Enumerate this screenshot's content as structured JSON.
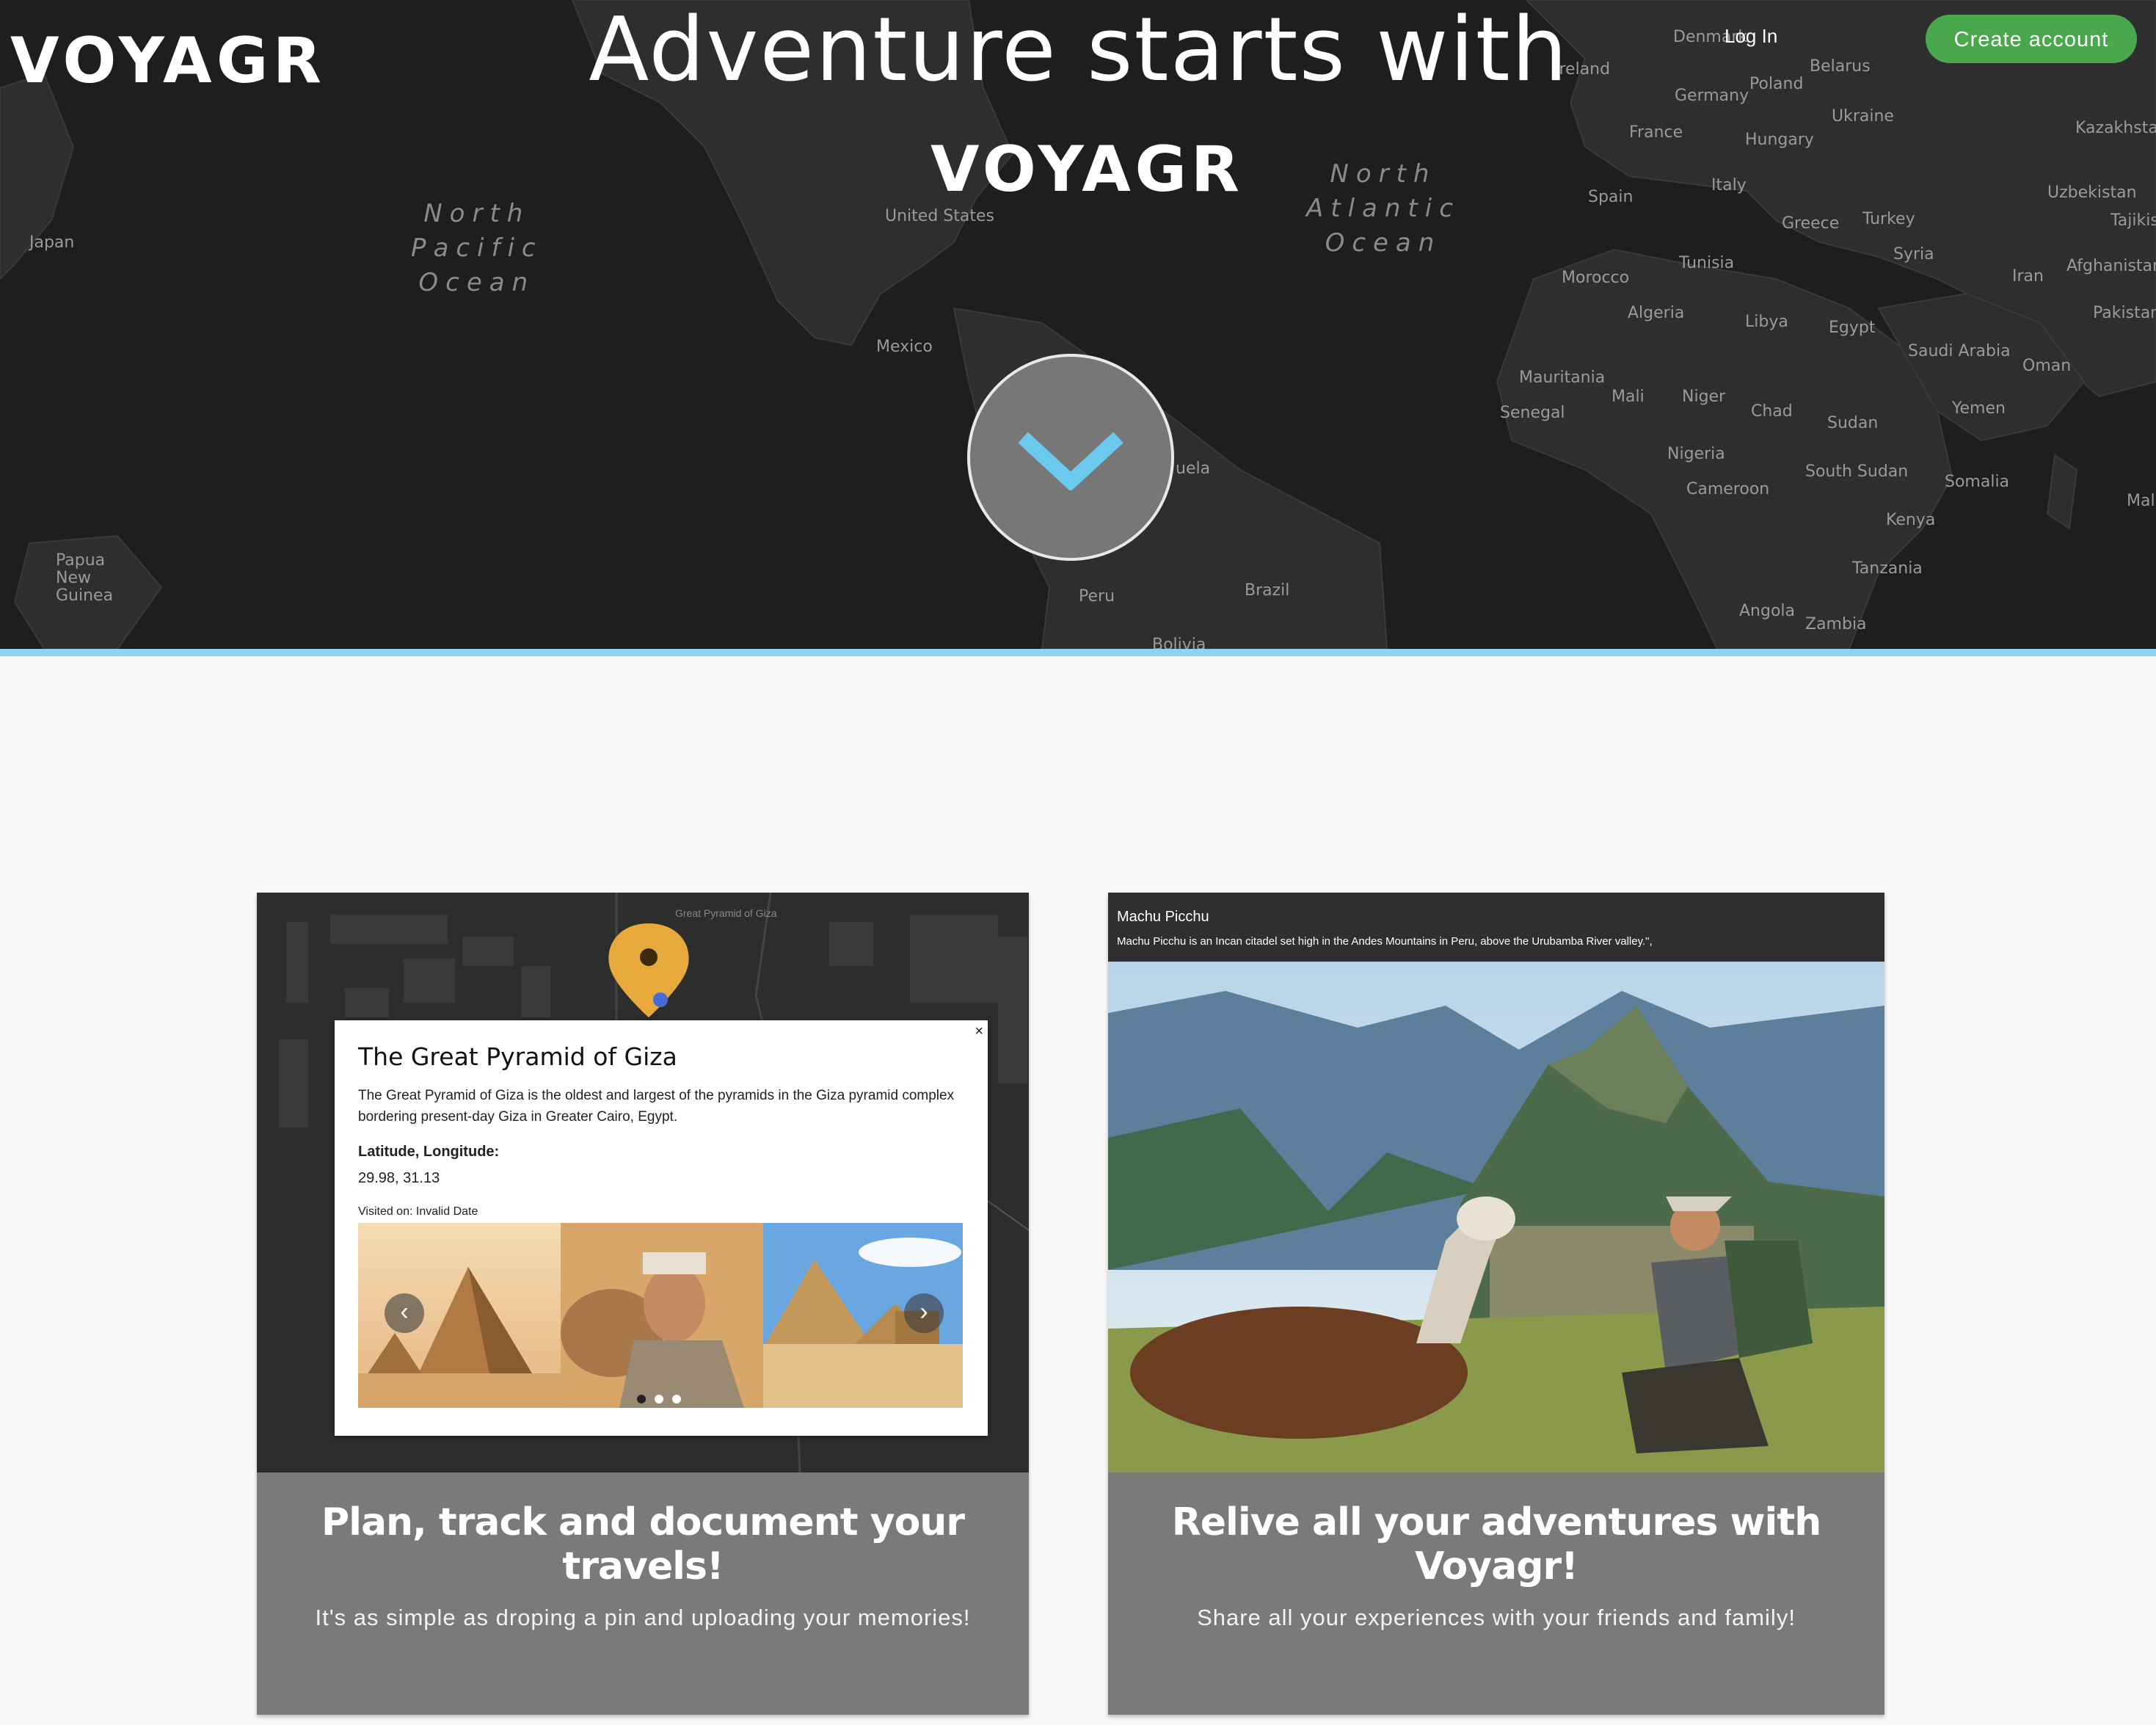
{
  "brand": {
    "logo_text": "VOYAGR"
  },
  "hero": {
    "headline": "Adventure starts with",
    "logo_text": "VOYAGR",
    "nav": {
      "login_label": "Log In",
      "create_account_label": "Create account"
    },
    "scroll_icon": "chevron-down-icon",
    "map_labels": [
      "Japan",
      "Papua New Guinea",
      "United States",
      "Mexico",
      "Brazil",
      "Peru",
      "Bolivia",
      "uela",
      "Ireland",
      "Denmark",
      "Belarus",
      "Poland",
      "Germany",
      "Ukraine",
      "France",
      "Hungary",
      "Kazakhstan",
      "Spain",
      "Italy",
      "Greece",
      "Turkey",
      "Uzbekistan",
      "Tajikis",
      "Morocco",
      "Tunisia",
      "Syria",
      "Iran",
      "Afghanistan",
      "Algeria",
      "Libya",
      "Egypt",
      "Pakistan",
      "Saudi Arabia",
      "Oman",
      "Mauritania",
      "Mali",
      "Niger",
      "Senegal",
      "Chad",
      "Sudan",
      "Yemen",
      "Nigeria",
      "South Sudan",
      "Somalia",
      "Cameroon",
      "Kenya",
      "Mal",
      "Tanzania",
      "Angola",
      "Zambia"
    ],
    "oceans": [
      "North\nPacific\nOcean",
      "North\nAtlantic\nOcean"
    ],
    "accent_border": "#8fd5f3"
  },
  "cards": [
    {
      "title": "Plan, track and document your travels!",
      "subtitle": "It's as simple as droping a pin and uploading your memories!",
      "map_pin_label": "Great Pyramid of Giza",
      "popup": {
        "title": "The Great Pyramid of Giza",
        "description": "The Great Pyramid of Giza is the oldest and largest of the pyramids in the Giza pyramid complex bordering present-day Giza in Greater Cairo, Egypt.",
        "latlng_label": "Latitude, Longitude:",
        "latlng_value": "29.98, 31.13",
        "visited_text": "Visited on: Invalid Date",
        "close_icon": "×",
        "prev_icon": "‹",
        "next_icon": "›"
      }
    },
    {
      "title": "Relive all your adventures with Voyagr!",
      "subtitle": "Share all your experiences with your friends and family!",
      "photo_title": "Machu Picchu",
      "photo_description": "Machu Picchu is an Incan citadel set high in the Andes Mountains in Peru, above the Urubamba River valley.\","
    }
  ],
  "colors": {
    "create_button": "#4aa84c",
    "card_bg": "#7a7a7a",
    "hero_bg": "#1e1e1e",
    "chevron": "#6cc9ee",
    "pin": "#e8a93c"
  }
}
